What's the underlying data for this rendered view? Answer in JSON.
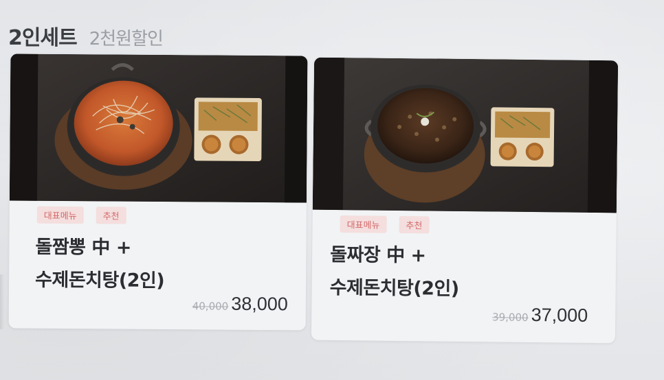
{
  "section": {
    "title": "2인세트",
    "subtitle": "2천원할인"
  },
  "menu_items": [
    {
      "tags": [
        "대표메뉴",
        "추천"
      ],
      "name_line1": "돌짬뽕 中 +",
      "name_line2": "수제돈치탕(2인)",
      "original_price": "40,000",
      "sale_price": "38,000",
      "image": "stone-pot-jjamppong-with-side-dishes"
    },
    {
      "tags": [
        "대표메뉴",
        "추천"
      ],
      "name_line1": "돌짜장 中 +",
      "name_line2": "수제돈치탕(2인)",
      "original_price": "39,000",
      "sale_price": "37,000",
      "image": "stone-pot-jjajang-with-side-dishes"
    }
  ],
  "colors": {
    "tag_text": "#d46a6a",
    "tag_bg": "#f4dede",
    "title": "#3a3d42",
    "subtitle": "#9a9ea4"
  }
}
